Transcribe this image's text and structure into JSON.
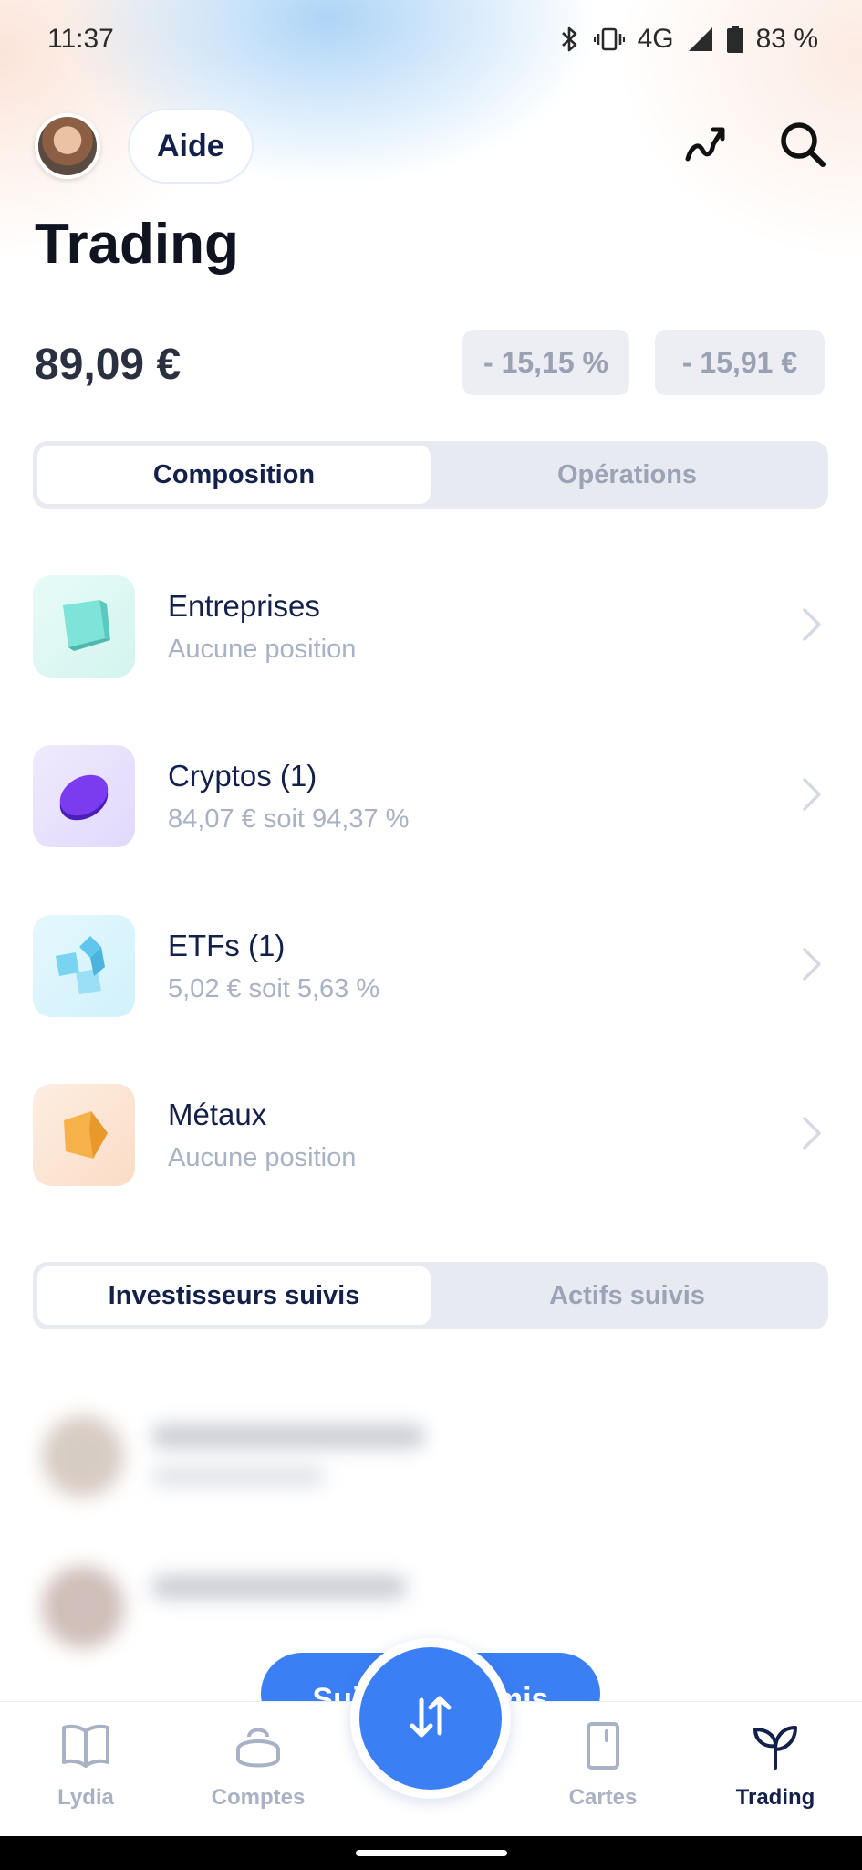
{
  "status_bar": {
    "time": "11:37",
    "network": "4G",
    "battery": "83 %"
  },
  "header": {
    "help_label": "Aide",
    "title": "Trading"
  },
  "portfolio": {
    "balance": "89,09 €",
    "perf_percent": "- 15,15 %",
    "perf_amount": "- 15,91 €"
  },
  "tabs_main": {
    "composition": "Composition",
    "operations": "Opérations",
    "active": "composition"
  },
  "categories": [
    {
      "title": "Entreprises",
      "subtitle": "Aucune position",
      "icon": "teal-cube-icon"
    },
    {
      "title": "Cryptos (1)",
      "subtitle": "84,07 € soit 94,37 %",
      "icon": "purple-coin-icon"
    },
    {
      "title": "ETFs (1)",
      "subtitle": "5,02 € soit 5,63 %",
      "icon": "blue-cubes-icon"
    },
    {
      "title": "Métaux",
      "subtitle": "Aucune position",
      "icon": "gold-ingot-icon"
    }
  ],
  "tabs_follow": {
    "investors": "Investisseurs suivis",
    "assets": "Actifs suivis",
    "active": "investors"
  },
  "follow_button": {
    "label": "Suivre des amis"
  },
  "bottom_nav": {
    "items": [
      {
        "label": "Lydia",
        "icon": "book-icon"
      },
      {
        "label": "Comptes",
        "icon": "wallet-icon"
      },
      {
        "label": "Cartes",
        "icon": "card-icon"
      },
      {
        "label": "Trading",
        "icon": "plant-icon",
        "active": true
      }
    ]
  },
  "colors": {
    "accent": "#3b7ff5",
    "text_primary": "#13204a",
    "text_muted": "#a9b1c4"
  }
}
